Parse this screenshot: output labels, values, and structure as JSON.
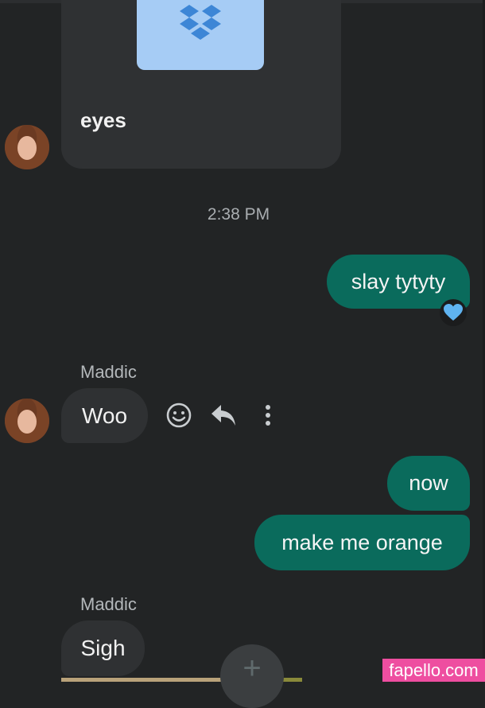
{
  "attachment": {
    "caption": "eyes",
    "icon": "dropbox-icon"
  },
  "timestamp": "2:38 PM",
  "messages": {
    "out1": "slay tytyty",
    "out1_reaction": "blue-heart",
    "sender1": "Maddic",
    "in1": "Woo",
    "out2": "now",
    "out3": "make me orange",
    "sender2": "Maddic",
    "in2": "Sigh"
  },
  "actions": {
    "react": "smiley-icon",
    "reply": "reply-icon",
    "more": "more-vert-icon"
  },
  "fab_icon": "add-icon",
  "watermark": "fapello.com",
  "colors": {
    "background": "#222425",
    "outgoing_bubble": "#0a6b5c",
    "incoming_bubble": "#2f3133",
    "dropbox_thumb": "#a6ccf5",
    "dropbox_logo": "#3d86d6",
    "watermark": "#ee4ea0"
  }
}
